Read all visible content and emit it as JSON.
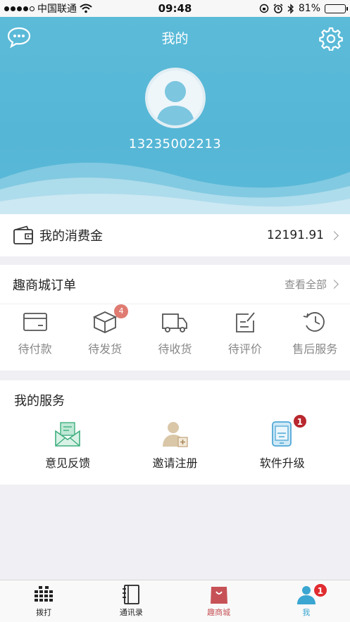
{
  "status_bar": {
    "carrier": "中国联通",
    "time": "09:48",
    "battery": "81%",
    "battery_level": 0.81
  },
  "header": {
    "title": "我的",
    "phone": "13235002213"
  },
  "wallet": {
    "label": "我的消费金",
    "amount": "12191.91"
  },
  "orders": {
    "title": "趣商城订单",
    "view_all": "查看全部",
    "items": [
      {
        "label": "待付款",
        "icon": "card-icon"
      },
      {
        "label": "待发货",
        "icon": "package-icon",
        "badge": "4"
      },
      {
        "label": "待收货",
        "icon": "truck-icon"
      },
      {
        "label": "待评价",
        "icon": "edit-note-icon"
      },
      {
        "label": "售后服务",
        "icon": "history-clock-icon"
      }
    ]
  },
  "services": {
    "title": "我的服务",
    "items": [
      {
        "label": "意见反馈",
        "icon": "mail-icon"
      },
      {
        "label": "邀请注册",
        "icon": "add-user-icon"
      },
      {
        "label": "软件升级",
        "icon": "phone-upgrade-icon",
        "badge": "1"
      }
    ]
  },
  "tabbar": {
    "items": [
      {
        "label": "拨打",
        "icon": "dialpad-icon"
      },
      {
        "label": "通讯录",
        "icon": "contacts-book-icon"
      },
      {
        "label": "趣商城",
        "icon": "shopping-bag-icon"
      },
      {
        "label": "我",
        "icon": "person-icon",
        "badge": "1"
      }
    ]
  },
  "colors": {
    "header_bg": "#56b6d6",
    "shop_accent": "#c65257",
    "me_accent": "#3aa6d1",
    "badge_light": "#e07b72",
    "badge_dark": "#b8282e"
  }
}
